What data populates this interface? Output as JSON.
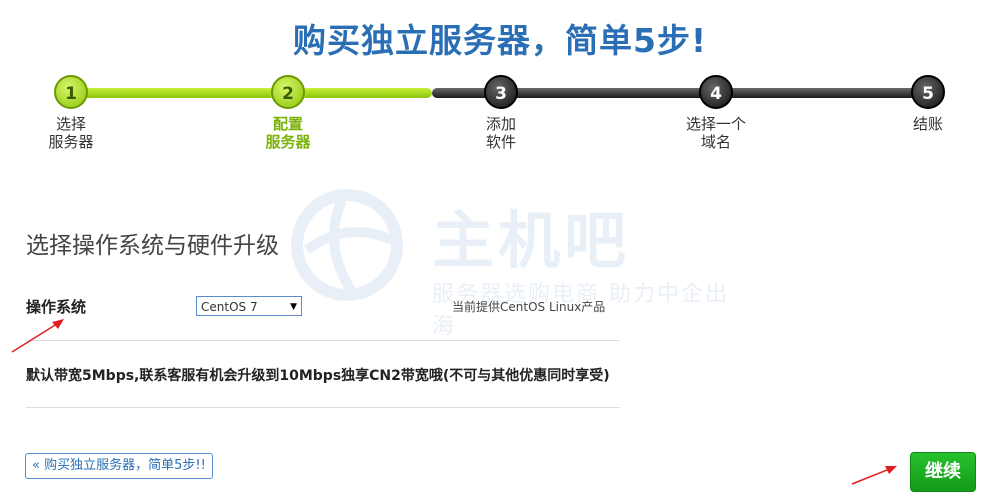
{
  "title": "购买独立服务器，简单5步!",
  "steps": [
    {
      "number": "1",
      "label": "选择\n服务器"
    },
    {
      "number": "2",
      "label": "配置\n服务器"
    },
    {
      "number": "3",
      "label": "添加\n软件"
    },
    {
      "number": "4",
      "label": "选择一个\n域名"
    },
    {
      "number": "5",
      "label": "结账"
    }
  ],
  "watermark": {
    "title": "主机吧",
    "subtitle": "服务器选购电商 助力中企出海"
  },
  "section_title": "选择操作系统与硬件升级",
  "os": {
    "label": "操作系统",
    "selected": "CentOS 7",
    "note": "当前提供CentOS Linux产品"
  },
  "promo": "默认带宽5Mbps,联系客服有机会升级到10Mbps独享CN2带宽哦(不可与其他优惠同时享受)",
  "back_button": "« 购买独立服务器，简单5步!!",
  "continue_button": "继续",
  "colors": {
    "accent_blue": "#2a6fb5",
    "step_green": "#8cc407",
    "continue_green": "#1fae23",
    "annotation_red": "#e02020"
  }
}
